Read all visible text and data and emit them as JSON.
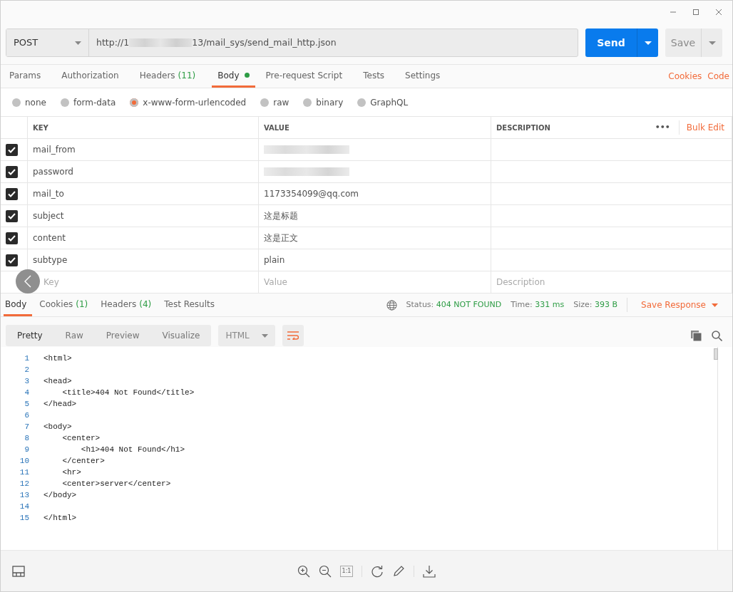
{
  "request": {
    "method": "POST",
    "url_start": "http://1",
    "url_end": "13/mail_sys/send_mail_http.json",
    "send": "Send",
    "save": "Save"
  },
  "tabs": [
    {
      "label": "Params",
      "selected": false
    },
    {
      "label": "Authorization",
      "selected": false
    },
    {
      "label": "Headers",
      "count": "(11)",
      "selected": false
    },
    {
      "label": "Body",
      "dot": true,
      "selected": true
    },
    {
      "label": "Pre-request Script",
      "selected": false
    },
    {
      "label": "Tests",
      "selected": false
    },
    {
      "label": "Settings",
      "selected": false
    }
  ],
  "tab_links": [
    "Cookies",
    "Code"
  ],
  "body_types": [
    {
      "label": "none",
      "selected": false
    },
    {
      "label": "form-data",
      "selected": false
    },
    {
      "label": "x-www-form-urlencoded",
      "selected": true
    },
    {
      "label": "raw",
      "selected": false
    },
    {
      "label": "binary",
      "selected": false
    },
    {
      "label": "GraphQL",
      "selected": false
    }
  ],
  "table": {
    "columns": [
      "KEY",
      "VALUE",
      "DESCRIPTION"
    ],
    "more": "•••",
    "bulk_edit": "Bulk Edit",
    "rows": [
      {
        "key": "mail_from",
        "kind": "redacted",
        "checked": true
      },
      {
        "key": "password",
        "kind": "redacted",
        "checked": true
      },
      {
        "key": "mail_to",
        "value": "1173354099@qq.com",
        "checked": true
      },
      {
        "key": "subject",
        "value": "这是标题",
        "checked": true
      },
      {
        "key": "content",
        "value": "这是正文",
        "checked": true
      },
      {
        "key": "subtype",
        "value": "plain",
        "checked": true
      }
    ],
    "placeholders": {
      "key": "Key",
      "value": "Value",
      "description": "Description"
    }
  },
  "response_tabs": [
    {
      "label": "Body",
      "selected": true
    },
    {
      "label": "Cookies",
      "count": "(1)",
      "selected": false
    },
    {
      "label": "Headers",
      "count": "(4)",
      "selected": false
    },
    {
      "label": "Test Results",
      "selected": false
    }
  ],
  "response_meta": [
    {
      "label": "Status:",
      "value": "404 NOT FOUND"
    },
    {
      "label": "Time:",
      "value": "331 ms"
    },
    {
      "label": "Size:",
      "value": "393 B"
    }
  ],
  "save_response": "Save Response",
  "view_modes": [
    {
      "label": "Pretty",
      "selected": true
    },
    {
      "label": "Raw",
      "selected": false
    },
    {
      "label": "Preview",
      "selected": false
    },
    {
      "label": "Visualize",
      "selected": false
    }
  ],
  "format": "HTML",
  "code": [
    {
      "number": "1",
      "text": "<html>"
    },
    {
      "number": "2"
    },
    {
      "number": "3",
      "text": "<head>"
    },
    {
      "number": "4",
      "text": "    <title>404 Not Found</title>"
    },
    {
      "number": "5",
      "text": "</head>"
    },
    {
      "number": "6"
    },
    {
      "number": "7",
      "text": "<body>"
    },
    {
      "number": "8",
      "text": "    <center>"
    },
    {
      "number": "9",
      "text": "        <h1>404 Not Found</h1>"
    },
    {
      "number": "10",
      "text": "    </center>"
    },
    {
      "number": "11",
      "text": "    <hr>"
    },
    {
      "number": "12",
      "text": "    <center>server</center>"
    },
    {
      "number": "13",
      "text": "</body>"
    },
    {
      "number": "14"
    },
    {
      "number": "15",
      "text": "</html>"
    }
  ],
  "footer": {
    "actual_size": "1:1"
  }
}
